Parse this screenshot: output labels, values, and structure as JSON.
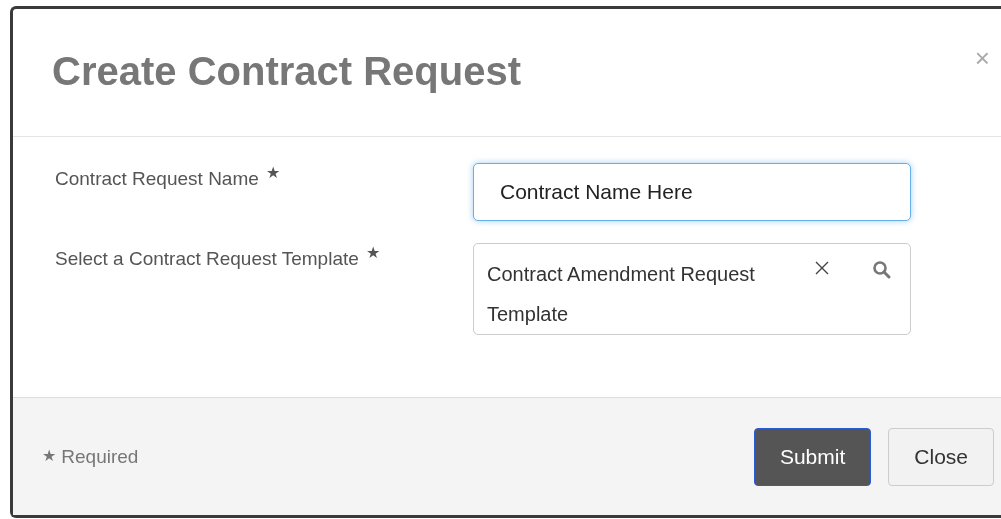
{
  "dialog": {
    "title": "Create Contract Request",
    "close_glyph": "×"
  },
  "fields": [
    {
      "kind": "text",
      "label": "Contract Request Name",
      "required_mark": "★",
      "value": "Contract Name Here",
      "focused": true
    },
    {
      "kind": "lookup",
      "label": "Select a Contract Request Template",
      "required_mark": "★",
      "value": "Contract Amendment Request Template",
      "focused": false
    }
  ],
  "footer": {
    "required_mark": "★",
    "required_note": "Required",
    "buttons": [
      {
        "label": "Submit",
        "kind": "primary"
      },
      {
        "label": "Close",
        "kind": "secondary"
      }
    ]
  }
}
